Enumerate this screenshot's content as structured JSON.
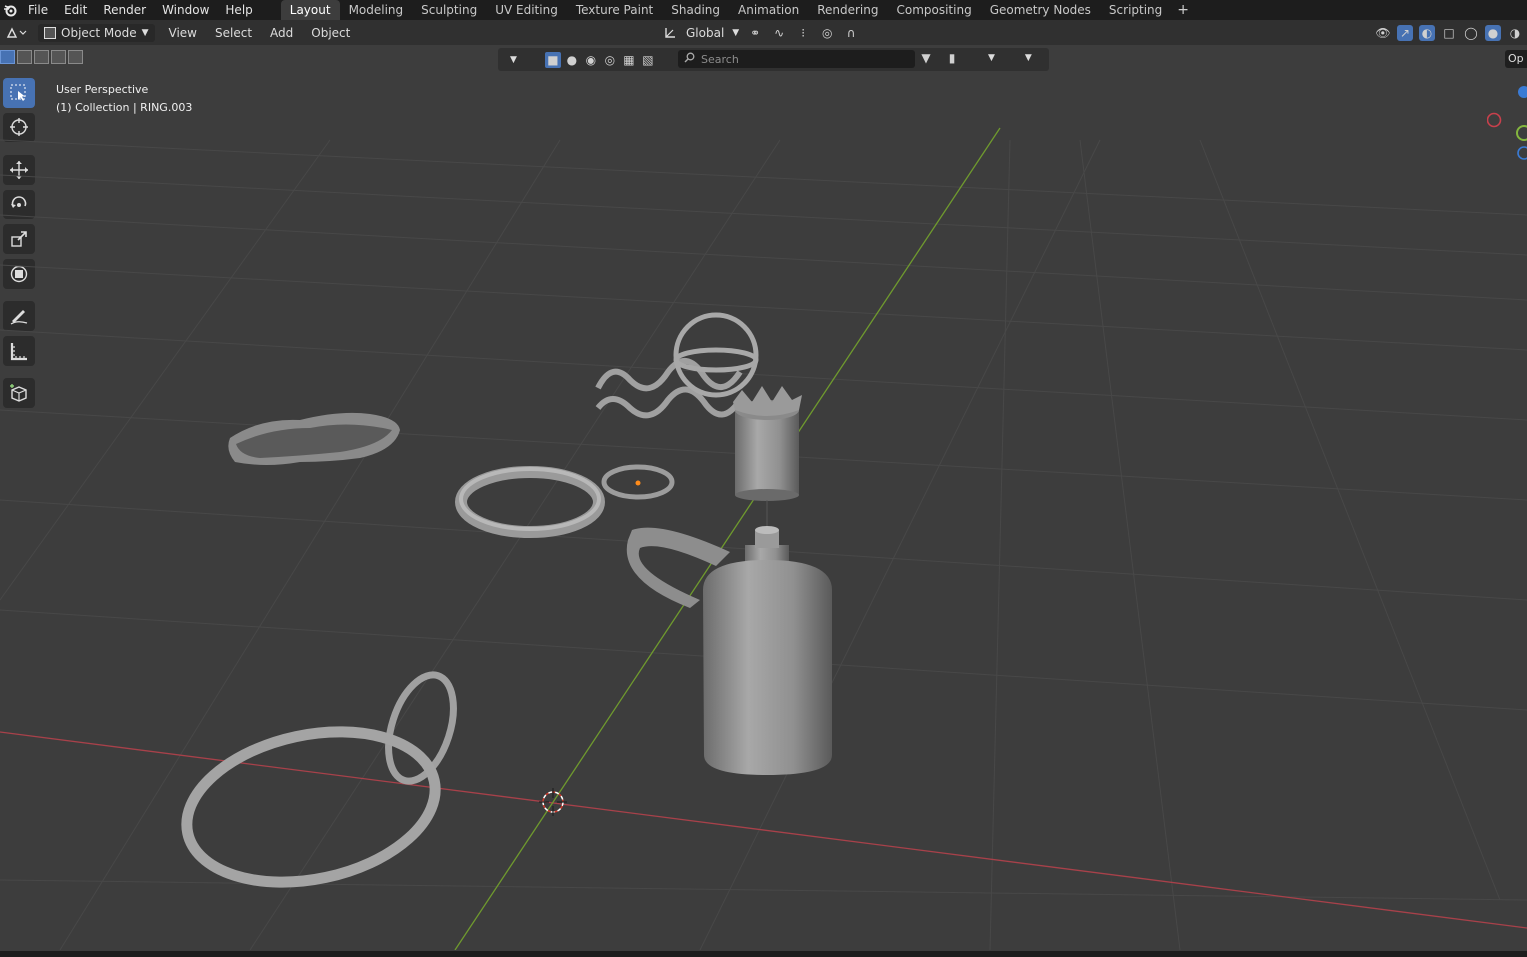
{
  "menu": {
    "file": "File",
    "edit": "Edit",
    "render": "Render",
    "window": "Window",
    "help": "Help"
  },
  "tabs": [
    "Layout",
    "Modeling",
    "Sculpting",
    "UV Editing",
    "Texture Paint",
    "Shading",
    "Animation",
    "Rendering",
    "Compositing",
    "Geometry Nodes",
    "Scripting"
  ],
  "header": {
    "mode": "Object Mode",
    "view": "View",
    "select": "Select",
    "add": "Add",
    "object": "Object",
    "orientation": "Global"
  },
  "viewport": {
    "search_placeholder": "Search",
    "option_label": "Op",
    "perspective": "User Perspective",
    "collection": "(1) Collection | RING.003"
  },
  "colors": {
    "accent": "#4772b3",
    "x_axis": "#b5404a",
    "y_axis": "#7aa03a",
    "z_axis": "#3a7bd5"
  },
  "icons": [
    "blender-logo-icon",
    "select-box-icon",
    "cursor-icon",
    "move-icon",
    "rotate-icon",
    "scale-icon",
    "transform-icon",
    "annotate-icon",
    "measure-icon",
    "add-cube-icon",
    "search-icon"
  ]
}
